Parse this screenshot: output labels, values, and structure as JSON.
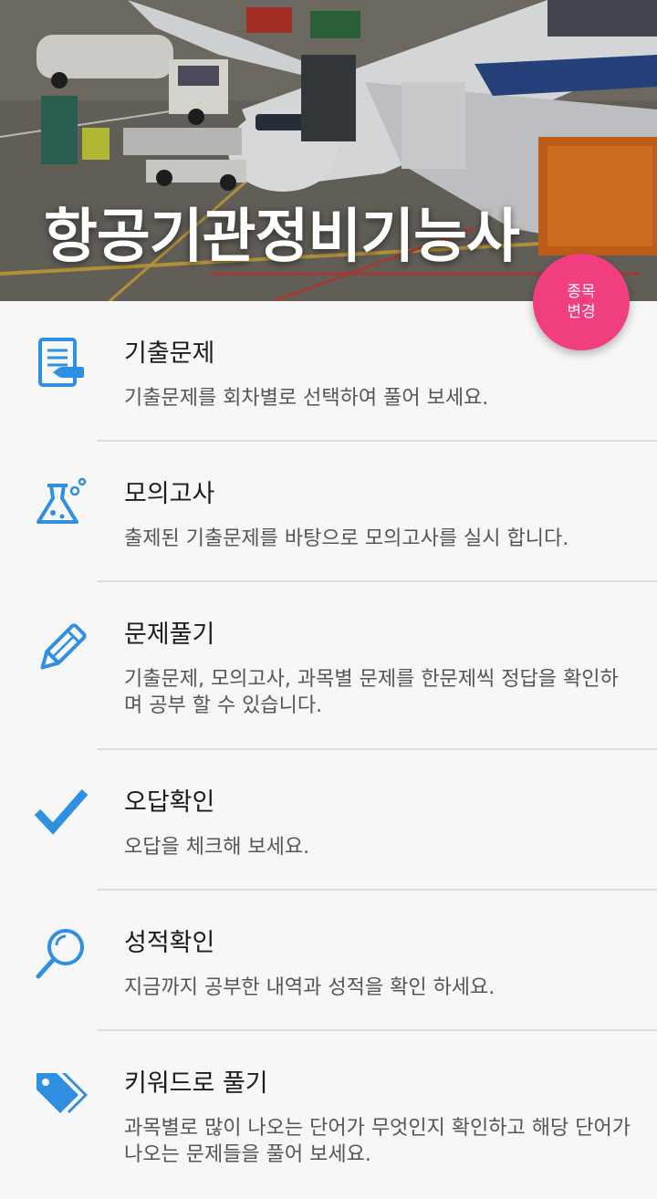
{
  "header": {
    "title": "항공기관정비기능사"
  },
  "fab": {
    "line1": "종목",
    "line2": "변경"
  },
  "menu": [
    {
      "title": "기출문제",
      "desc": "기출문제를 회차별로 선택하여 풀어 보세요.",
      "icon": "notebook-icon"
    },
    {
      "title": "모의고사",
      "desc": "출제된 기출문제를 바탕으로 모의고사를 실시 합니다.",
      "icon": "flask-icon"
    },
    {
      "title": "문제풀기",
      "desc": "기출문제, 모의고사, 과목별 문제를 한문제씩 정답을 확인하며 공부 할 수 있습니다.",
      "icon": "pencil-icon"
    },
    {
      "title": "오답확인",
      "desc": "오답을 체크해 보세요.",
      "icon": "checkmark-icon"
    },
    {
      "title": "성적확인",
      "desc": "지금까지 공부한 내역과 성적을 확인 하세요.",
      "icon": "magnifier-icon"
    },
    {
      "title": "키워드로 풀기",
      "desc": "과목별로 많이 나오는 단어가 무엇인지 확인하고 해당 단어가 나오는 문제들을 풀어 보세요.",
      "icon": "tags-icon"
    }
  ],
  "colors": {
    "accent": "#f03e7f",
    "icon": "#2f8fe0"
  }
}
